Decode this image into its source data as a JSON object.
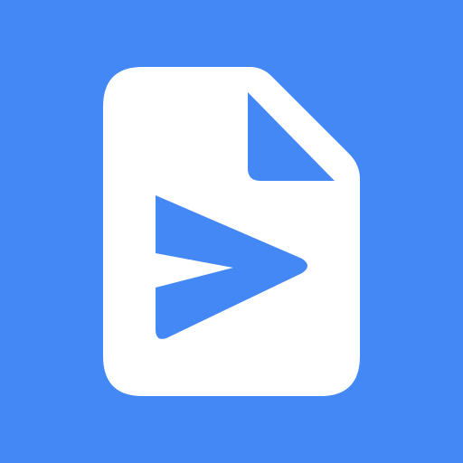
{
  "icon": {
    "name": "document-send-icon",
    "colors": {
      "background": "#4488f5",
      "document": "#ffffff",
      "accent": "#4488f5"
    }
  }
}
